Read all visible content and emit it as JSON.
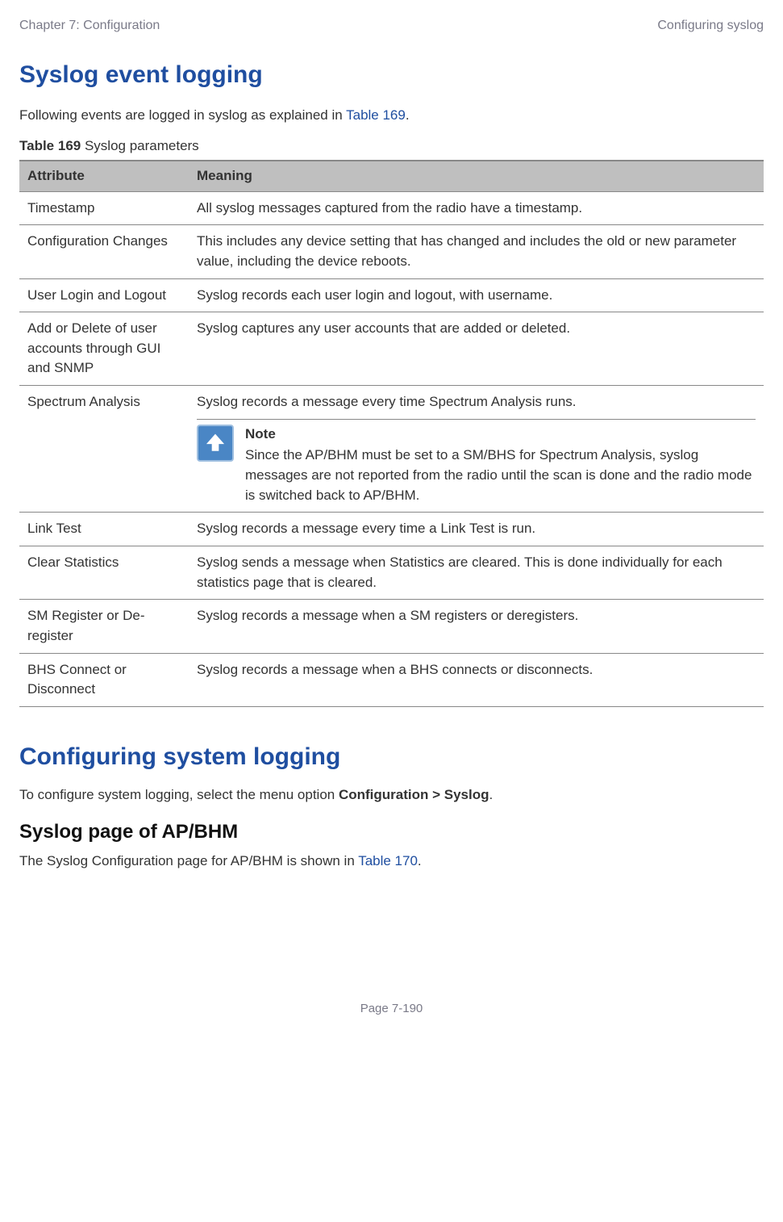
{
  "header": {
    "left": "Chapter 7:  Configuration",
    "right": "Configuring syslog"
  },
  "section1": {
    "title": "Syslog event logging",
    "intro_pre": "Following events are logged in syslog as explained in ",
    "intro_link": "Table 169",
    "intro_post": ".",
    "table_caption_bold": "Table 169",
    "table_caption_rest": " Syslog parameters",
    "headers": {
      "attr": "Attribute",
      "meaning": "Meaning"
    },
    "rows": [
      {
        "attr": "Timestamp",
        "meaning": "All syslog messages captured from the radio have a timestamp."
      },
      {
        "attr": "Configuration Changes",
        "meaning": "This includes any device setting that has changed and includes the old or new parameter value, including the device reboots."
      },
      {
        "attr": "User Login and Logout",
        "meaning": "Syslog records each user login and logout, with username."
      },
      {
        "attr": "Add or Delete of user accounts through GUI and SNMP",
        "meaning": "Syslog captures any user accounts that are added or deleted."
      },
      {
        "attr": "Spectrum Analysis",
        "meaning": "Syslog records a message every time Spectrum Analysis runs.",
        "note_title": "Note",
        "note_body": "Since the AP/BHM must be set to a SM/BHS for Spectrum Analysis, syslog messages are not reported from the radio until the scan is done and the radio mode is switched back to AP/BHM."
      },
      {
        "attr": "Link Test",
        "meaning": "Syslog records a message every time a Link Test is run."
      },
      {
        "attr": "Clear Statistics",
        "meaning": "Syslog sends a message when Statistics are cleared. This is done individually for each statistics page that is cleared."
      },
      {
        "attr": "SM Register or De-register",
        "meaning": "Syslog records a message when a SM registers or deregisters."
      },
      {
        "attr": "BHS Connect or Disconnect",
        "meaning": "Syslog records a message when a BHS connects or disconnects."
      }
    ]
  },
  "section2": {
    "title": "Configuring system logging",
    "intro_pre": "To configure system logging, select the menu option ",
    "intro_bold": "Configuration > Syslog",
    "intro_post": ".",
    "subtitle": "Syslog page of AP/BHM",
    "sub_intro_pre": "The Syslog Configuration page for AP/BHM is shown in ",
    "sub_intro_link": "Table 170",
    "sub_intro_post": "."
  },
  "footer": "Page 7-190"
}
